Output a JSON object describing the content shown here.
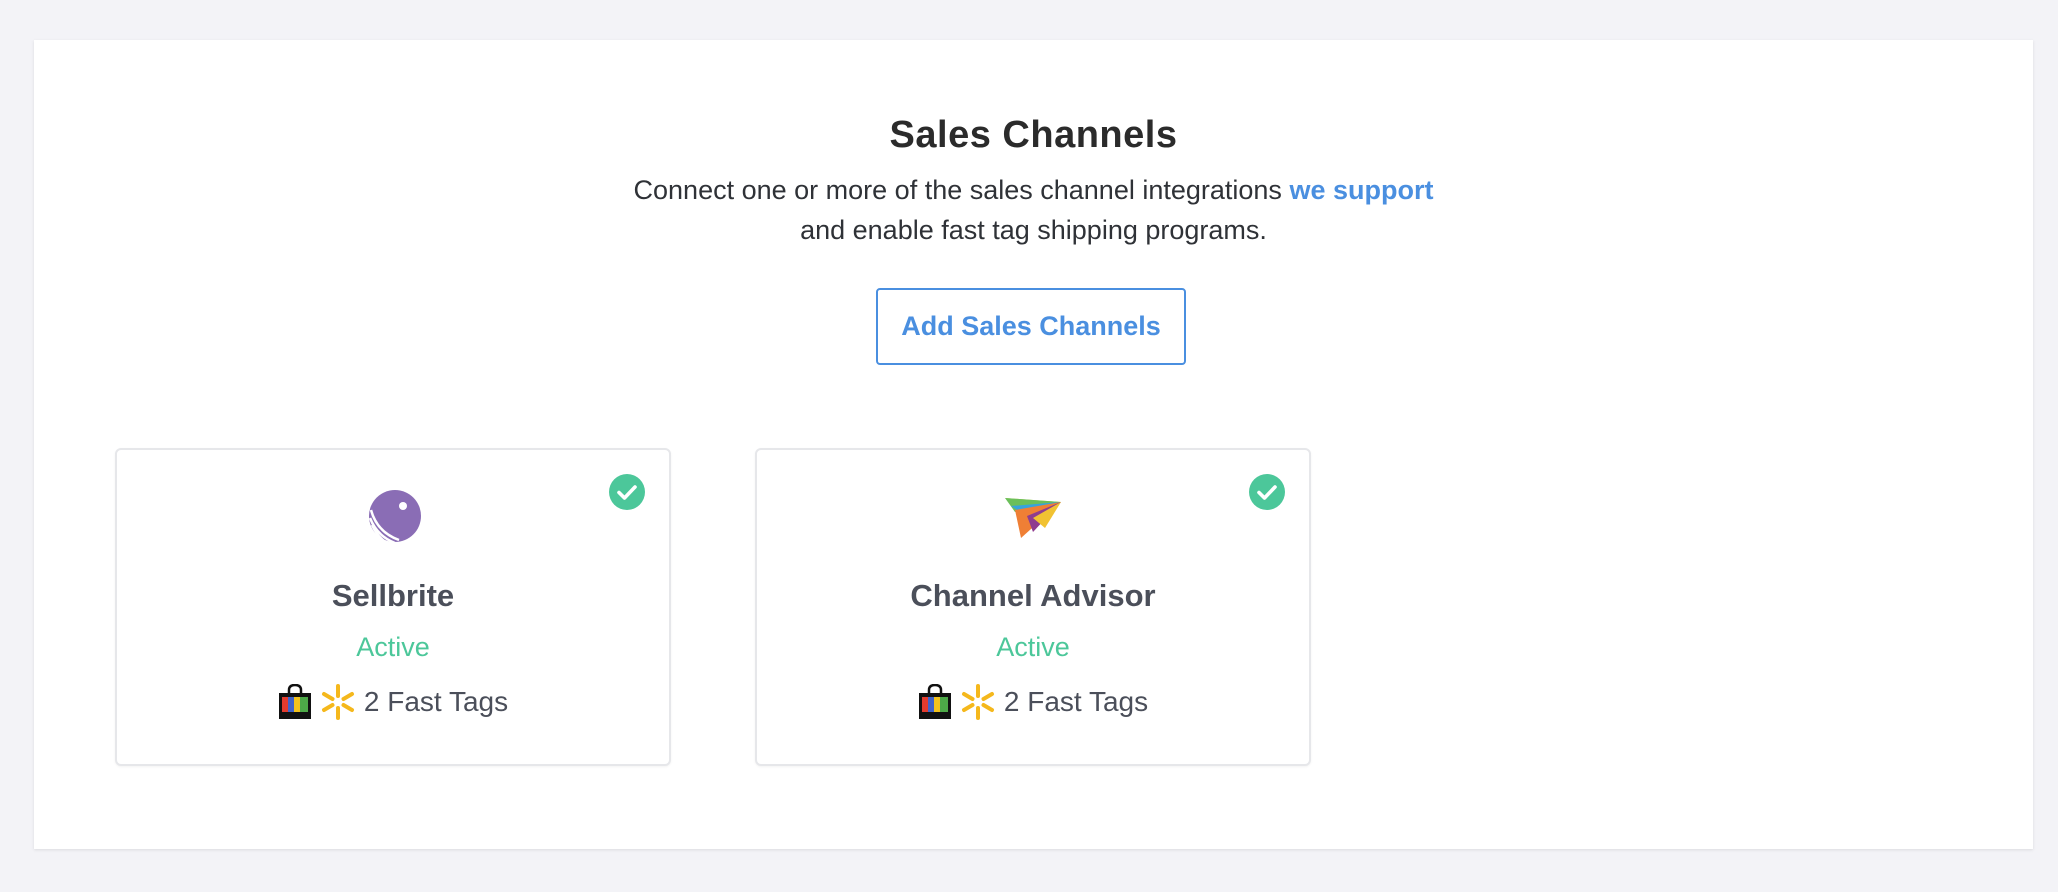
{
  "header": {
    "title": "Sales Channels",
    "subtitle_prefix": "Connect one or more of the sales channel integrations ",
    "subtitle_link": "we support",
    "subtitle_line2": "and enable fast tag shipping programs."
  },
  "actions": {
    "add_label": "Add Sales Channels"
  },
  "channels": [
    {
      "name": "Sellbrite",
      "status": "Active",
      "fast_tags": "2 Fast Tags",
      "icon": "sellbrite-logo"
    },
    {
      "name": "Channel Advisor",
      "status": "Active",
      "fast_tags": "2 Fast Tags",
      "icon": "channeladvisor-logo"
    }
  ],
  "colors": {
    "accent": "#4a8fe0",
    "active": "#4cc79a",
    "check": "#4cc79a",
    "sellbrite": "#8a6db5"
  }
}
